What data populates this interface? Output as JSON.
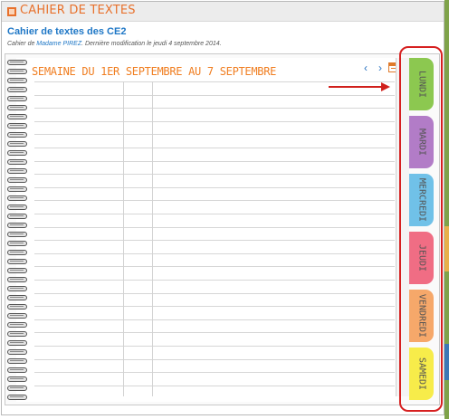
{
  "header": {
    "title": "CAHIER DE TEXTES",
    "icon": "notebook-icon"
  },
  "panel": {
    "title": "Cahier de textes des CE2",
    "subtitle_prefix": "Cahier de ",
    "author": "Madame PIREZ",
    "subtitle_suffix": ". Dernière modification le jeudi 4 septembre 2014."
  },
  "notebook": {
    "week_title": "SEMAINE DU 1ER SEPTEMBRE AU 7 SEPTEMBRE",
    "prev_label": "‹",
    "next_label": "›",
    "calendar_icon": "calendar-icon"
  },
  "tabs": [
    {
      "label": "LUNDI",
      "color": "#8cc850"
    },
    {
      "label": "MARDI",
      "color": "#b27cc7"
    },
    {
      "label": "MERCREDI",
      "color": "#70c1e8"
    },
    {
      "label": "JEUDI",
      "color": "#f06d84"
    },
    {
      "label": "VENDREDI",
      "color": "#f6a86a"
    },
    {
      "label": "SAMEDI",
      "color": "#f7ec4a"
    }
  ],
  "colors": {
    "accent_orange": "#e8712c",
    "title_blue": "#1e77c6",
    "annotation_red": "#d0201c"
  }
}
